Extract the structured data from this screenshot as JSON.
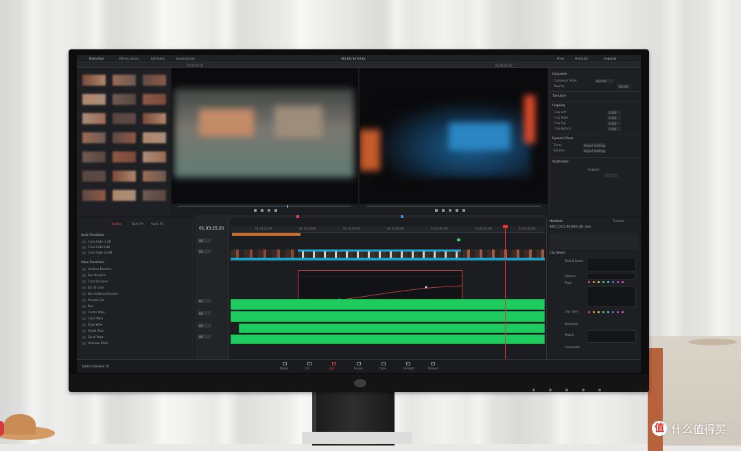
{
  "app": {
    "menu": [
      "Media Pool",
      "Effects Library",
      "Edit Index",
      "Sound Library"
    ],
    "menu_right": [
      "Mixer",
      "Metadata",
      "Inspector"
    ],
    "project_title": "4K2 Dio 4K Art Ka"
  },
  "viewer": {
    "source_timecode": "01:03:25:07",
    "timeline_timecode": "01:03:25:20"
  },
  "timeline": {
    "timecode": "01:03:25:20",
    "ruler_ticks": [
      "01:03:22:00",
      "01:03:24:00",
      "01:03:26:00",
      "01:03:28:00",
      "01:03:30:00",
      "01:03:32:00",
      "01:03:34:00"
    ],
    "tracks": [
      "V2",
      "V1",
      "A1",
      "A2",
      "A3",
      "A4"
    ]
  },
  "effects": {
    "tabs": [
      "Toolbox",
      "Open FX",
      "Audio FX"
    ],
    "section_audio": "Audio Transitions",
    "audio_items": [
      "Cross Fade -3 dB",
      "Cross Fade 0 dB",
      "Cross Fade +3 dB"
    ],
    "section_video": "Video Transitions",
    "video_items": [
      "Additive Dissolve",
      "Blur Dissolve",
      "Cross Dissolve",
      "Dip To Color",
      "Non-Additive Dissolve",
      "Smooth Cut",
      "Box",
      "Center Wipe",
      "Clock Wipe",
      "Edge Wipe",
      "Radial Wipe",
      "Spiral Wipe",
      "Venetian Blind"
    ]
  },
  "inspector": {
    "sections": [
      "Composite",
      "Transform",
      "Cropping",
      "Dynamic Zoom",
      "Stabilization"
    ],
    "labels": [
      "Composite Mode",
      "Opacity",
      "Crop Left",
      "Crop Right",
      "Crop Top",
      "Crop Bottom",
      "Softness",
      "Zoom",
      "Position",
      "Rotation"
    ],
    "values": [
      "Normal",
      "100.00",
      "0.000",
      "0.000",
      "0.000",
      "0.000",
      "Project Settings",
      "Project Settings",
      "Enabled"
    ]
  },
  "metadata": {
    "tabs": [
      "Metadata",
      "Timeline"
    ],
    "clip_name": "A001_C013_0614XK_001.mov",
    "fields": [
      "Clip Details",
      "Shot & Scene",
      "Camera",
      "Flags",
      "Clip Color",
      "Keywords",
      "People",
      "Comments"
    ]
  },
  "pagenav": {
    "brand": "DaVinci Resolve 18",
    "pages": [
      "Media",
      "Cut",
      "Edit",
      "Fusion",
      "Color",
      "Fairlight",
      "Deliver"
    ]
  },
  "watermark": {
    "logo": "值",
    "text": "什么值得买"
  }
}
